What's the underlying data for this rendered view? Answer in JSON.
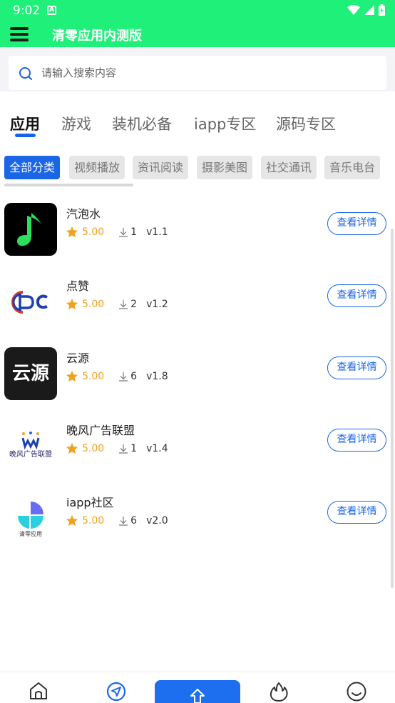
{
  "status_bar": {
    "time": "9:02",
    "notification_letter": "A"
  },
  "header": {
    "title": "清零应用内测版"
  },
  "search": {
    "placeholder": "请输入搜索内容"
  },
  "tabs": [
    {
      "label": "应用",
      "active": true
    },
    {
      "label": "游戏",
      "active": false
    },
    {
      "label": "装机必备",
      "active": false
    },
    {
      "label": "iapp专区",
      "active": false
    },
    {
      "label": "源码专区",
      "active": false
    }
  ],
  "chips": [
    {
      "label": "全部分类",
      "active": true
    },
    {
      "label": "视频播放",
      "active": false
    },
    {
      "label": "资讯阅读",
      "active": false
    },
    {
      "label": "摄影美图",
      "active": false
    },
    {
      "label": "社交通讯",
      "active": false
    },
    {
      "label": "音乐电台",
      "active": false
    }
  ],
  "apps": [
    {
      "name": "汽泡水",
      "rating": "5.00",
      "downloads": "1",
      "version": "v1.1",
      "button": "查看详情",
      "icon": "music-note-icon"
    },
    {
      "name": "点赞",
      "rating": "5.00",
      "downloads": "2",
      "version": "v1.2",
      "button": "查看详情",
      "icon": "dc-logo-icon"
    },
    {
      "name": "云源",
      "rating": "5.00",
      "downloads": "6",
      "version": "v1.8",
      "button": "查看详情",
      "icon": "yunyuan-logo-icon",
      "icon_text": "云源"
    },
    {
      "name": "晚风广告联盟",
      "rating": "5.00",
      "downloads": "1",
      "version": "v1.4",
      "button": "查看详情",
      "icon": "wanfeng-logo-icon",
      "icon_text": "晚风广告联盟"
    },
    {
      "name": "iapp社区",
      "rating": "5.00",
      "downloads": "6",
      "version": "v2.0",
      "button": "查看详情",
      "icon": "qingling-logo-icon",
      "icon_text": "清零应用"
    }
  ],
  "bottom_nav": [
    {
      "icon": "home-icon"
    },
    {
      "icon": "navigation-icon"
    },
    {
      "icon": "upload-icon"
    },
    {
      "icon": "fire-icon"
    },
    {
      "icon": "smile-icon"
    }
  ],
  "colors": {
    "accent": "#1a66e6",
    "appbar": "#1ff07a",
    "rating": "#f0a21f"
  }
}
